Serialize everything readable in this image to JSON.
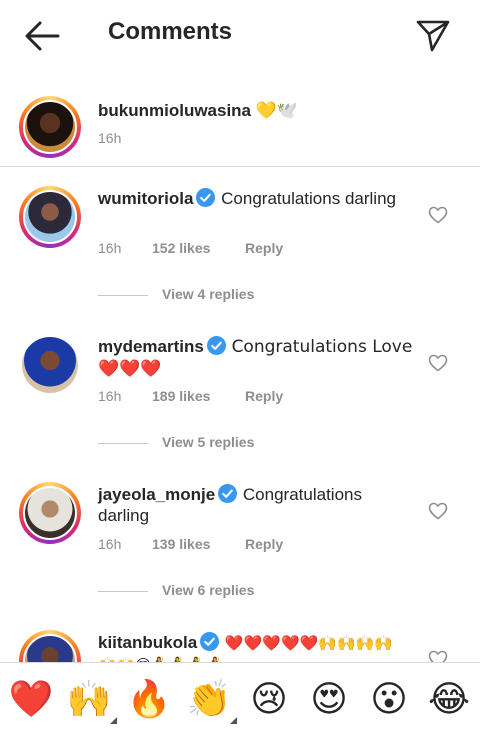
{
  "header": {
    "title": "Comments"
  },
  "caption": {
    "username": "bukunmioluwasina",
    "emoji": "💛🕊️",
    "time": "16h"
  },
  "comments": [
    {
      "username": "wumitoriola",
      "verified": true,
      "text": "Congratulations darling",
      "time": "16h",
      "likes": "152 likes",
      "reply": "Reply",
      "view_replies": "View 4 replies"
    },
    {
      "username": "mydemartins",
      "verified": true,
      "text": "Congratulations Love ❤️❤️❤️",
      "time": "16h",
      "likes": "189 likes",
      "reply": "Reply",
      "view_replies": "View 5 replies"
    },
    {
      "username": "jayeola_monje",
      "verified": true,
      "text": "Congratulations darling",
      "time": "16h",
      "likes": "139 likes",
      "reply": "Reply",
      "view_replies": "View 6 replies"
    },
    {
      "username": "kiitanbukola",
      "verified": true,
      "text": "❤️❤️❤️❤️❤️🙌🙌🙌🙌🙌🙌😍💃💃💃💃"
    }
  ],
  "reactions": [
    {
      "emoji": "❤️",
      "icon": "red-heart-icon"
    },
    {
      "emoji": "🙌",
      "icon": "raising-hands-icon"
    },
    {
      "emoji": "🔥",
      "icon": "fire-icon"
    },
    {
      "emoji": "👏",
      "icon": "clapping-hands-icon"
    },
    {
      "emoji": "😢",
      "icon": "crying-face-icon"
    },
    {
      "emoji": "😍",
      "icon": "heart-eyes-icon"
    },
    {
      "emoji": "😮",
      "icon": "surprised-face-icon"
    },
    {
      "emoji": "😂",
      "icon": "tears-of-joy-icon"
    }
  ],
  "colors": {
    "verified": "#3897f0",
    "text": "#262626",
    "muted": "#8e8e8e",
    "divider": "#dbdbdb"
  }
}
